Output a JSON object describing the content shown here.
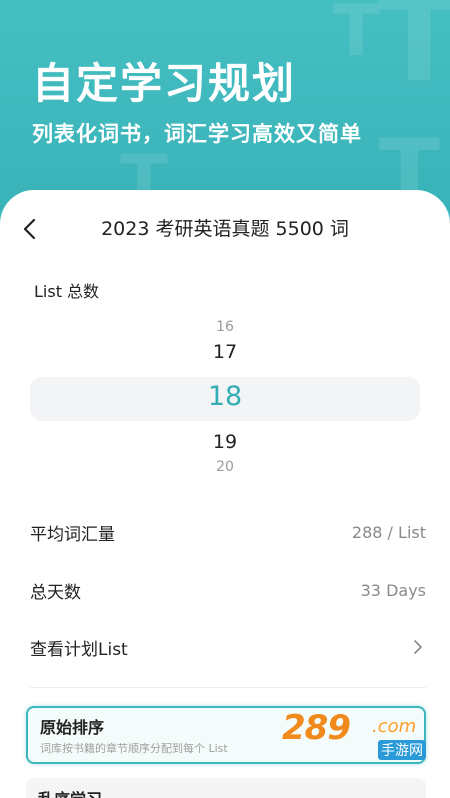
{
  "hero": {
    "title": "自定学习规划",
    "subtitle": "列表化词书，词汇学习高效又简单"
  },
  "nav": {
    "back_icon": "chevron-left-icon",
    "title": "2023 考研英语真题 5500 词"
  },
  "list_count": {
    "label": "List 总数",
    "options": [
      "16",
      "17",
      "18",
      "19",
      "20"
    ],
    "selected": "18"
  },
  "stats": {
    "avg_label": "平均词汇量",
    "avg_value": "288 / List",
    "days_label": "总天数",
    "days_value": "33 Days",
    "view_plan_label": "查看计划List"
  },
  "order_options": [
    {
      "title": "原始排序",
      "desc": "词库按书籍的章节顺序分配到每个 List"
    },
    {
      "title": "乱序学习"
    }
  ],
  "watermark": {
    "num": "289",
    "com": ".com",
    "cn": "手游网"
  },
  "colors": {
    "accent": "#3db7bb",
    "hero_bg": "#3fb9bd",
    "watermark": "#f08a1c"
  }
}
